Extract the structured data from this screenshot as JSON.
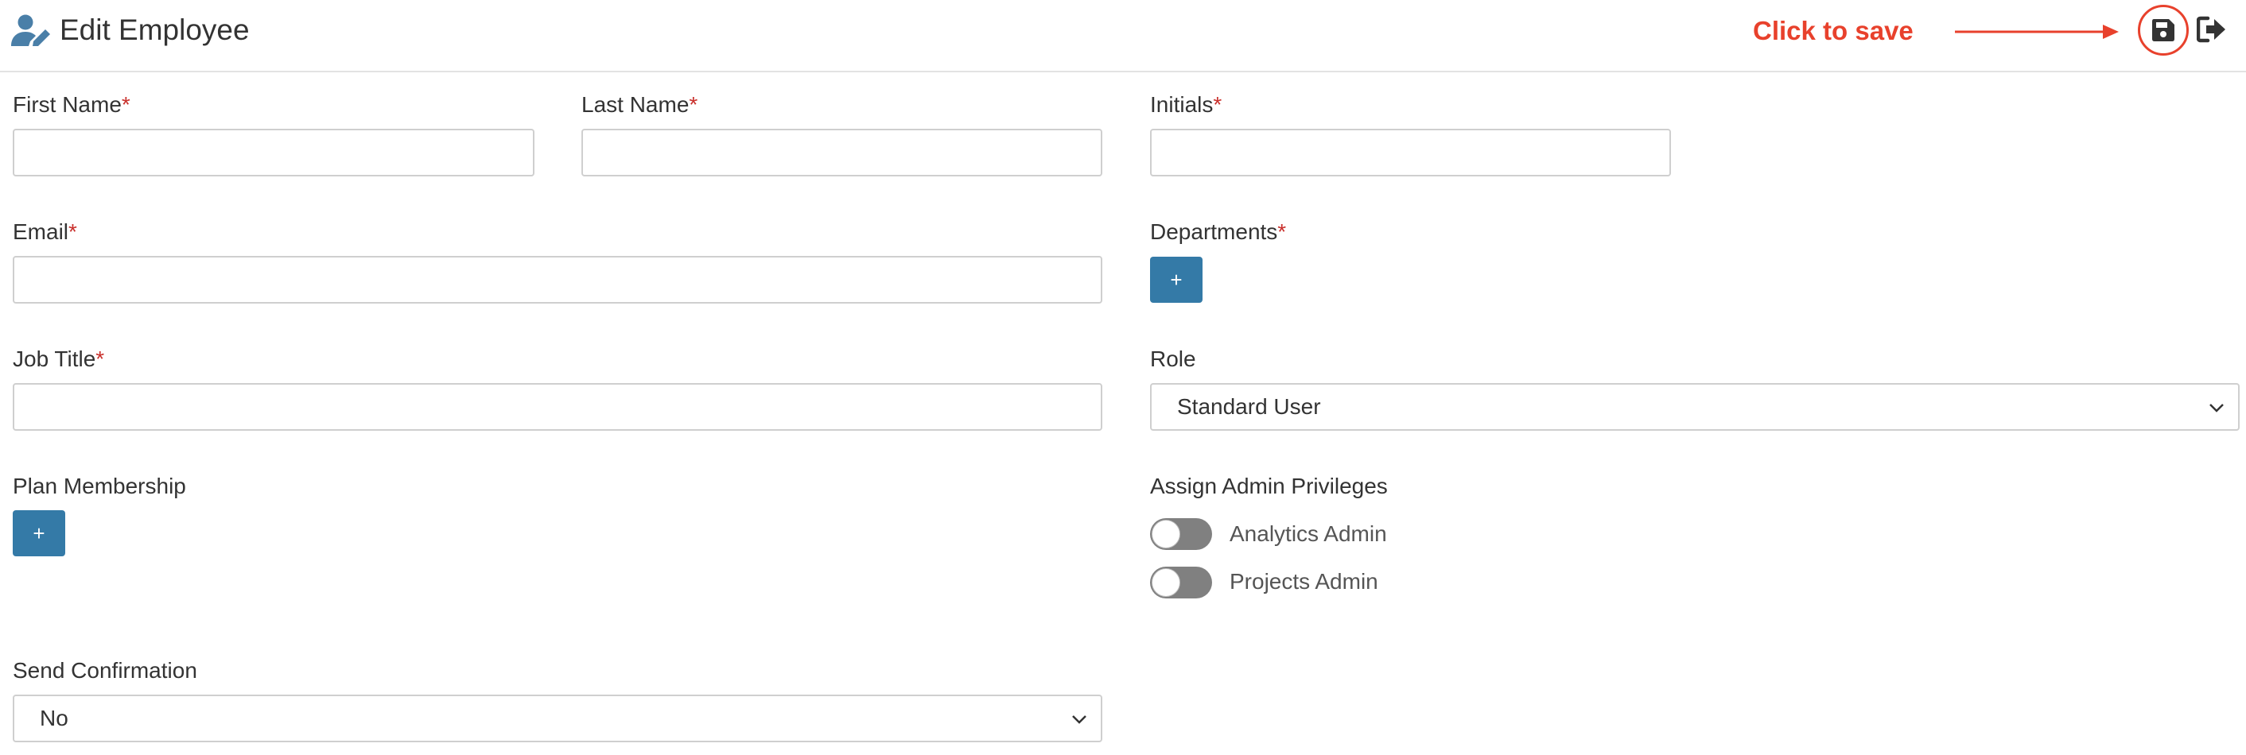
{
  "header": {
    "title": "Edit Employee",
    "title_icon": "user-edit-icon",
    "annotation_text": "Click to save",
    "save_icon": "floppy-disk-icon",
    "exit_icon": "sign-out-icon"
  },
  "colors": {
    "primary": "#347aa7",
    "annotation": "#e8412c",
    "required": "#c9302c",
    "toggle_off": "#808080",
    "title_icon": "#4a7fa8"
  },
  "form": {
    "first_name": {
      "label": "First Name",
      "required": "*",
      "value": ""
    },
    "last_name": {
      "label": "Last Name",
      "required": "*",
      "value": ""
    },
    "initials": {
      "label": "Initials",
      "required": "*",
      "value": ""
    },
    "email": {
      "label": "Email",
      "required": "*",
      "value": ""
    },
    "departments": {
      "label": "Departments",
      "required": "*",
      "add_label": "+"
    },
    "job_title": {
      "label": "Job Title",
      "required": "*",
      "value": ""
    },
    "role": {
      "label": "Role",
      "selected": "Standard User"
    },
    "plan_membership": {
      "label": "Plan Membership",
      "add_label": "+"
    },
    "admin_privileges": {
      "label": "Assign Admin Privileges",
      "items": [
        {
          "label": "Analytics Admin",
          "enabled": false
        },
        {
          "label": "Projects Admin",
          "enabled": false
        }
      ]
    },
    "send_confirmation": {
      "label": "Send Confirmation",
      "selected": "No"
    }
  }
}
